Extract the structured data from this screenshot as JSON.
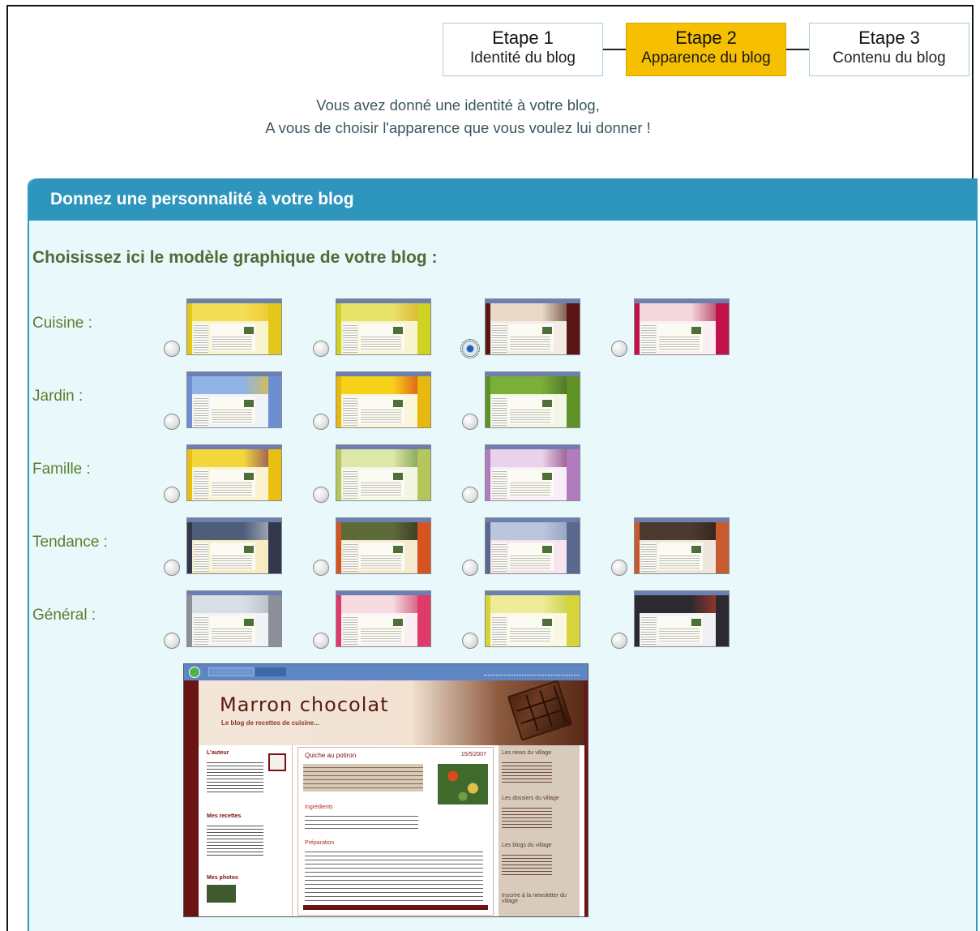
{
  "steps": [
    {
      "number": "Etape 1",
      "label": "Identité du blog",
      "active": false
    },
    {
      "number": "Etape 2",
      "label": "Apparence du blog",
      "active": true
    },
    {
      "number": "Etape 3",
      "label": "Contenu du blog",
      "active": false
    }
  ],
  "intro": {
    "line1": "Vous avez donné une identité à votre blog,",
    "line2": "A vous de choisir l'apparence que vous voulez lui donner !"
  },
  "panel": {
    "title": "Donnez une personnalité à votre blog",
    "subtitle": "Choisissez ici le modèle graphique de votre blog :"
  },
  "categories": [
    {
      "label": "Cuisine :",
      "count": 4
    },
    {
      "label": "Jardin :",
      "count": 3
    },
    {
      "label": "Famille :",
      "count": 3
    },
    {
      "label": "Tendance :",
      "count": 4
    },
    {
      "label": "Général :",
      "count": 4
    }
  ],
  "selected": {
    "category": "Cuisine :",
    "index": 3
  },
  "themes": [
    [
      {
        "banner": "#f2df56",
        "side": "#e3c81b",
        "bg": "#f7f3cc",
        "accent": "#f0c020"
      },
      {
        "banner": "#e8e46a",
        "side": "#cfd125",
        "bg": "#f7f5cf",
        "accent": "#d6a51a"
      },
      {
        "banner": "#ead9c8",
        "side": "#5c1515",
        "bg": "#f3ece4",
        "accent": "#4a2412"
      },
      {
        "banner": "#f4d7de",
        "side": "#c2124a",
        "bg": "#fbeef2",
        "accent": "#a8143e"
      }
    ],
    [
      {
        "banner": "#8fb4e6",
        "side": "#6d8ed2",
        "bg": "#eef3f8",
        "accent": "#f0c020"
      },
      {
        "banner": "#f6d21a",
        "side": "#e8b80e",
        "bg": "#fbf6d8",
        "accent": "#d83018"
      },
      {
        "banner": "#7cae3a",
        "side": "#5f9226",
        "bg": "#f1f6e6",
        "accent": "#3a5e1a"
      }
    ],
    [
      {
        "banner": "#f3d63a",
        "side": "#e9c012",
        "bg": "#fbf3cf",
        "accent": "#7a2a6a"
      },
      {
        "banner": "#dce7a8",
        "side": "#b7c65a",
        "bg": "#f4f6e4",
        "accent": "#6a8a3a"
      },
      {
        "banner": "#ead2ec",
        "side": "#b17cbd",
        "bg": "#f7eef8",
        "accent": "#7a2a6a"
      }
    ],
    [
      {
        "banner": "#4d5d7a",
        "side": "#32384c",
        "bg": "#f6ecc4",
        "accent": "#c8c8c8"
      },
      {
        "banner": "#5d6a3a",
        "side": "#d55422",
        "bg": "#f6ebcf",
        "accent": "#2e2a1a"
      },
      {
        "banner": "#b9c6dc",
        "side": "#5a6890",
        "bg": "#f6e4ef",
        "accent": "#8a97b8"
      },
      {
        "banner": "#4c3a30",
        "side": "#c85a30",
        "bg": "#efe7de",
        "accent": "#2a1c16"
      }
    ],
    [
      {
        "banner": "#d9dde6",
        "side": "#8a8f9a",
        "bg": "#f2f3f6",
        "accent": "#b0b4be"
      },
      {
        "banner": "#f6dbe2",
        "side": "#de3a6a",
        "bg": "#fbeff3",
        "accent": "#c82a5a"
      },
      {
        "banner": "#eeeb9a",
        "side": "#d7d33a",
        "bg": "#f9f8e2",
        "accent": "#c0c82a"
      },
      {
        "banner": "#2a2a30",
        "side": "#2a2a30",
        "bg": "#eef0f4",
        "accent": "#c83a2a"
      }
    ]
  ],
  "preview": {
    "blog_title": "Marron chocolat",
    "tagline": "Le blog de recettes de cuisine...",
    "sections": {
      "author": "L'auteur",
      "recipes": "Mes recettes",
      "photos": "Mes photos"
    },
    "post_title": "Quiche au potiron",
    "post_date": "15/5/2007",
    "ingredients": "Ingrédients",
    "preparation": "Préparation",
    "right_headers": [
      "Les news du village",
      "Les dossiers du village",
      "Les blogs du village",
      "Inscrire à la newsletter du village"
    ]
  },
  "colors": {
    "panel_header": "#2e95bd",
    "panel_bg": "#e8f8fb",
    "active_step": "#f6bf00",
    "label_green": "#5a7f2e"
  }
}
